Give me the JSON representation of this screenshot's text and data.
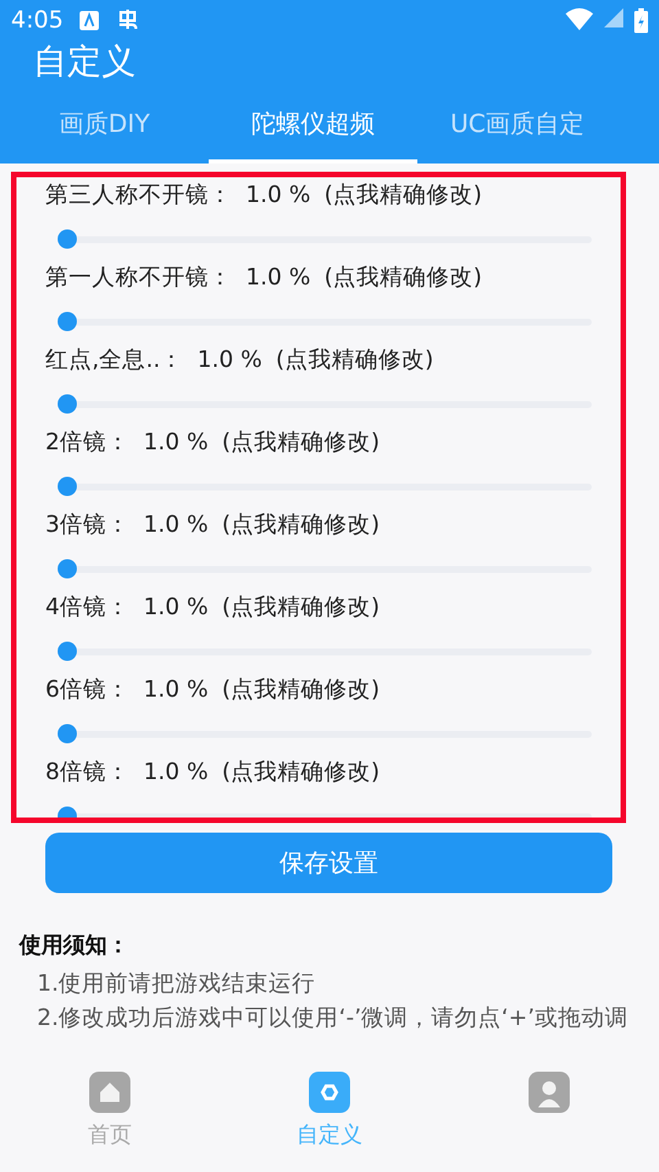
{
  "status_bar": {
    "time": "4:05"
  },
  "app_bar": {
    "title": "自定义"
  },
  "tabs": [
    {
      "label": "画质DIY",
      "selected": false
    },
    {
      "label": "陀螺仪超频",
      "selected": true
    },
    {
      "label": "UC画质自定",
      "selected": false
    }
  ],
  "settings": [
    {
      "name": "第三人称不开镜：",
      "value": "1.0 %",
      "action": "(点我精确修改)",
      "level": 0
    },
    {
      "name": "第一人称不开镜：",
      "value": "1.0 %",
      "action": "(点我精确修改)",
      "level": 0
    },
    {
      "name": "红点,全息..：",
      "value": "1.0 %",
      "action": "(点我精确修改)",
      "level": 0
    },
    {
      "name": "2倍镜：",
      "value": "1.0 %",
      "action": "(点我精确修改)",
      "level": 0
    },
    {
      "name": "3倍镜：",
      "value": "1.0 %",
      "action": "(点我精确修改)",
      "level": 0
    },
    {
      "name": "4倍镜：",
      "value": "1.0 %",
      "action": "(点我精确修改)",
      "level": 0
    },
    {
      "name": "6倍镜：",
      "value": "1.0 %",
      "action": "(点我精确修改)",
      "level": 0
    },
    {
      "name": "8倍镜：",
      "value": "1.0 %",
      "action": "(点我精确修改)",
      "level": 0
    }
  ],
  "save_button": "保存设置",
  "notice": {
    "title": "使用须知：",
    "items": [
      "1.使用前请把游戏结束运行",
      "2.修改成功后游戏中可以使用‘-’微调，请勿点‘+’或拖动调"
    ]
  },
  "bottom_nav": [
    {
      "kind": "home",
      "label": "首页",
      "selected": false
    },
    {
      "kind": "custom",
      "label": "自定义",
      "selected": true
    },
    {
      "kind": "user",
      "selected": false
    }
  ]
}
